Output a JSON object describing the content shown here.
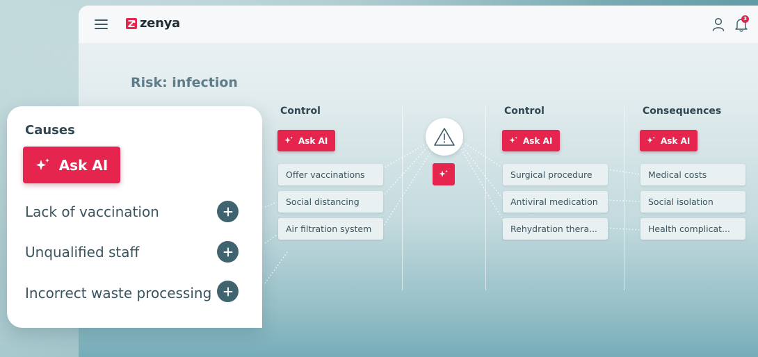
{
  "brand": {
    "name": "zenya",
    "accent": "#e6254f"
  },
  "header": {
    "menu_icon": "hamburger-icon",
    "user_icon": "user-icon",
    "bell_icon": "bell-icon",
    "notification_count": "3"
  },
  "risk": {
    "title": "Risk: infection"
  },
  "left_control": {
    "heading": "Control",
    "ask_ai_label": "Ask AI",
    "items": [
      "Offer vaccinations",
      "Social distancing",
      "Air filtration system"
    ]
  },
  "hazard": {
    "icon": "warning-triangle-icon",
    "ai_icon": "sparkle-icon"
  },
  "right_control": {
    "heading": "Control",
    "ask_ai_label": "Ask AI",
    "items": [
      "Surgical procedure",
      "Antiviral medication",
      "Rehydration thera..."
    ]
  },
  "consequences": {
    "heading": "Consequences",
    "ask_ai_label": "Ask AI",
    "items": [
      "Medical costs",
      "Social isolation",
      "Health complicat..."
    ]
  },
  "causes": {
    "heading": "Causes",
    "ask_ai_label": "Ask AI",
    "items": [
      "Lack of vaccination",
      "Unqualified staff",
      "Incorrect waste processing"
    ]
  }
}
